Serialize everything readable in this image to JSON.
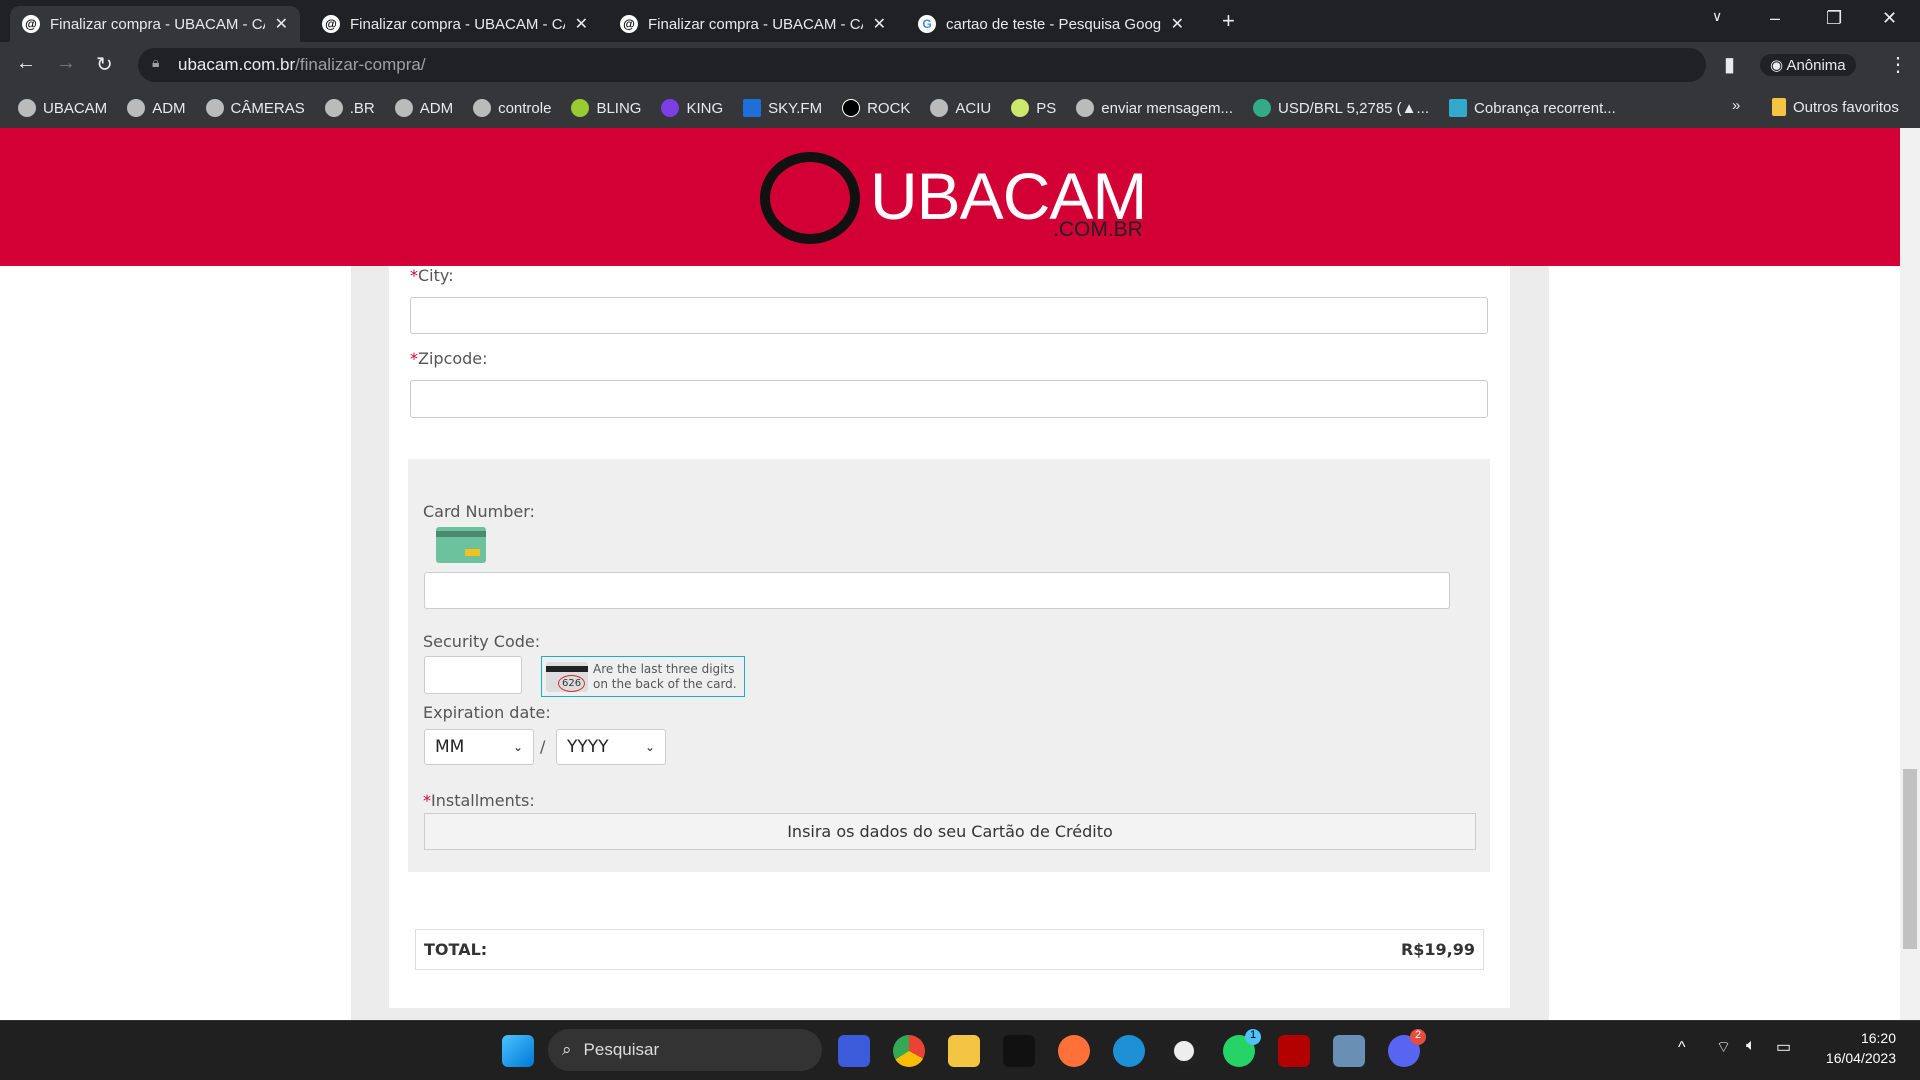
{
  "browser": {
    "tabs": [
      {
        "title": "Finalizar compra - UBACAM - CÂ",
        "active": true
      },
      {
        "title": "Finalizar compra - UBACAM - CÂ",
        "active": false
      },
      {
        "title": "Finalizar compra - UBACAM - CÂ",
        "active": false
      },
      {
        "title": "cartao de teste - Pesquisa Google",
        "active": false
      }
    ],
    "url_host": "ubacam.com.br",
    "url_path": "/finalizar-compra/",
    "profile": "Anônima",
    "bookmarks": [
      "UBACAM",
      "ADM",
      "CÂMERAS",
      ".BR",
      "ADM",
      "controle",
      "BLING",
      "KING",
      "SKY.FM",
      "ROCK",
      "ACIU",
      "PS",
      "enviar mensagem...",
      "USD/BRL 5,2785 (▲...",
      "Cobrança recorrent..."
    ],
    "more_bookmarks": "»",
    "other_favorites": "Outros favoritos"
  },
  "site": {
    "logo_name": "UBACAM",
    "logo_domain": ".COM.BR",
    "brand_color": "#d20034"
  },
  "form": {
    "required_mark": "*",
    "city_label": "City:",
    "zipcode_label": "Zipcode:",
    "card_number_label": "Card Number:",
    "security_code_label": "Security Code:",
    "security_hint": "Are the last three digits on the back of the card.",
    "cvv_example": "626",
    "expiration_label": "Expiration date:",
    "month_placeholder": "MM",
    "year_placeholder": "YYYY",
    "date_separator": "/",
    "installments_label": "Installments:",
    "installments_text": "Insira os dados do seu Cartão de Crédito",
    "total_label": "TOTAL:",
    "total_value": "R$19,99"
  },
  "taskbar": {
    "search": "Pesquisar",
    "time": "16:20",
    "date": "16/04/2023",
    "chrome_badge": "",
    "whatsapp_badge": "1",
    "discord_badge": "2"
  }
}
